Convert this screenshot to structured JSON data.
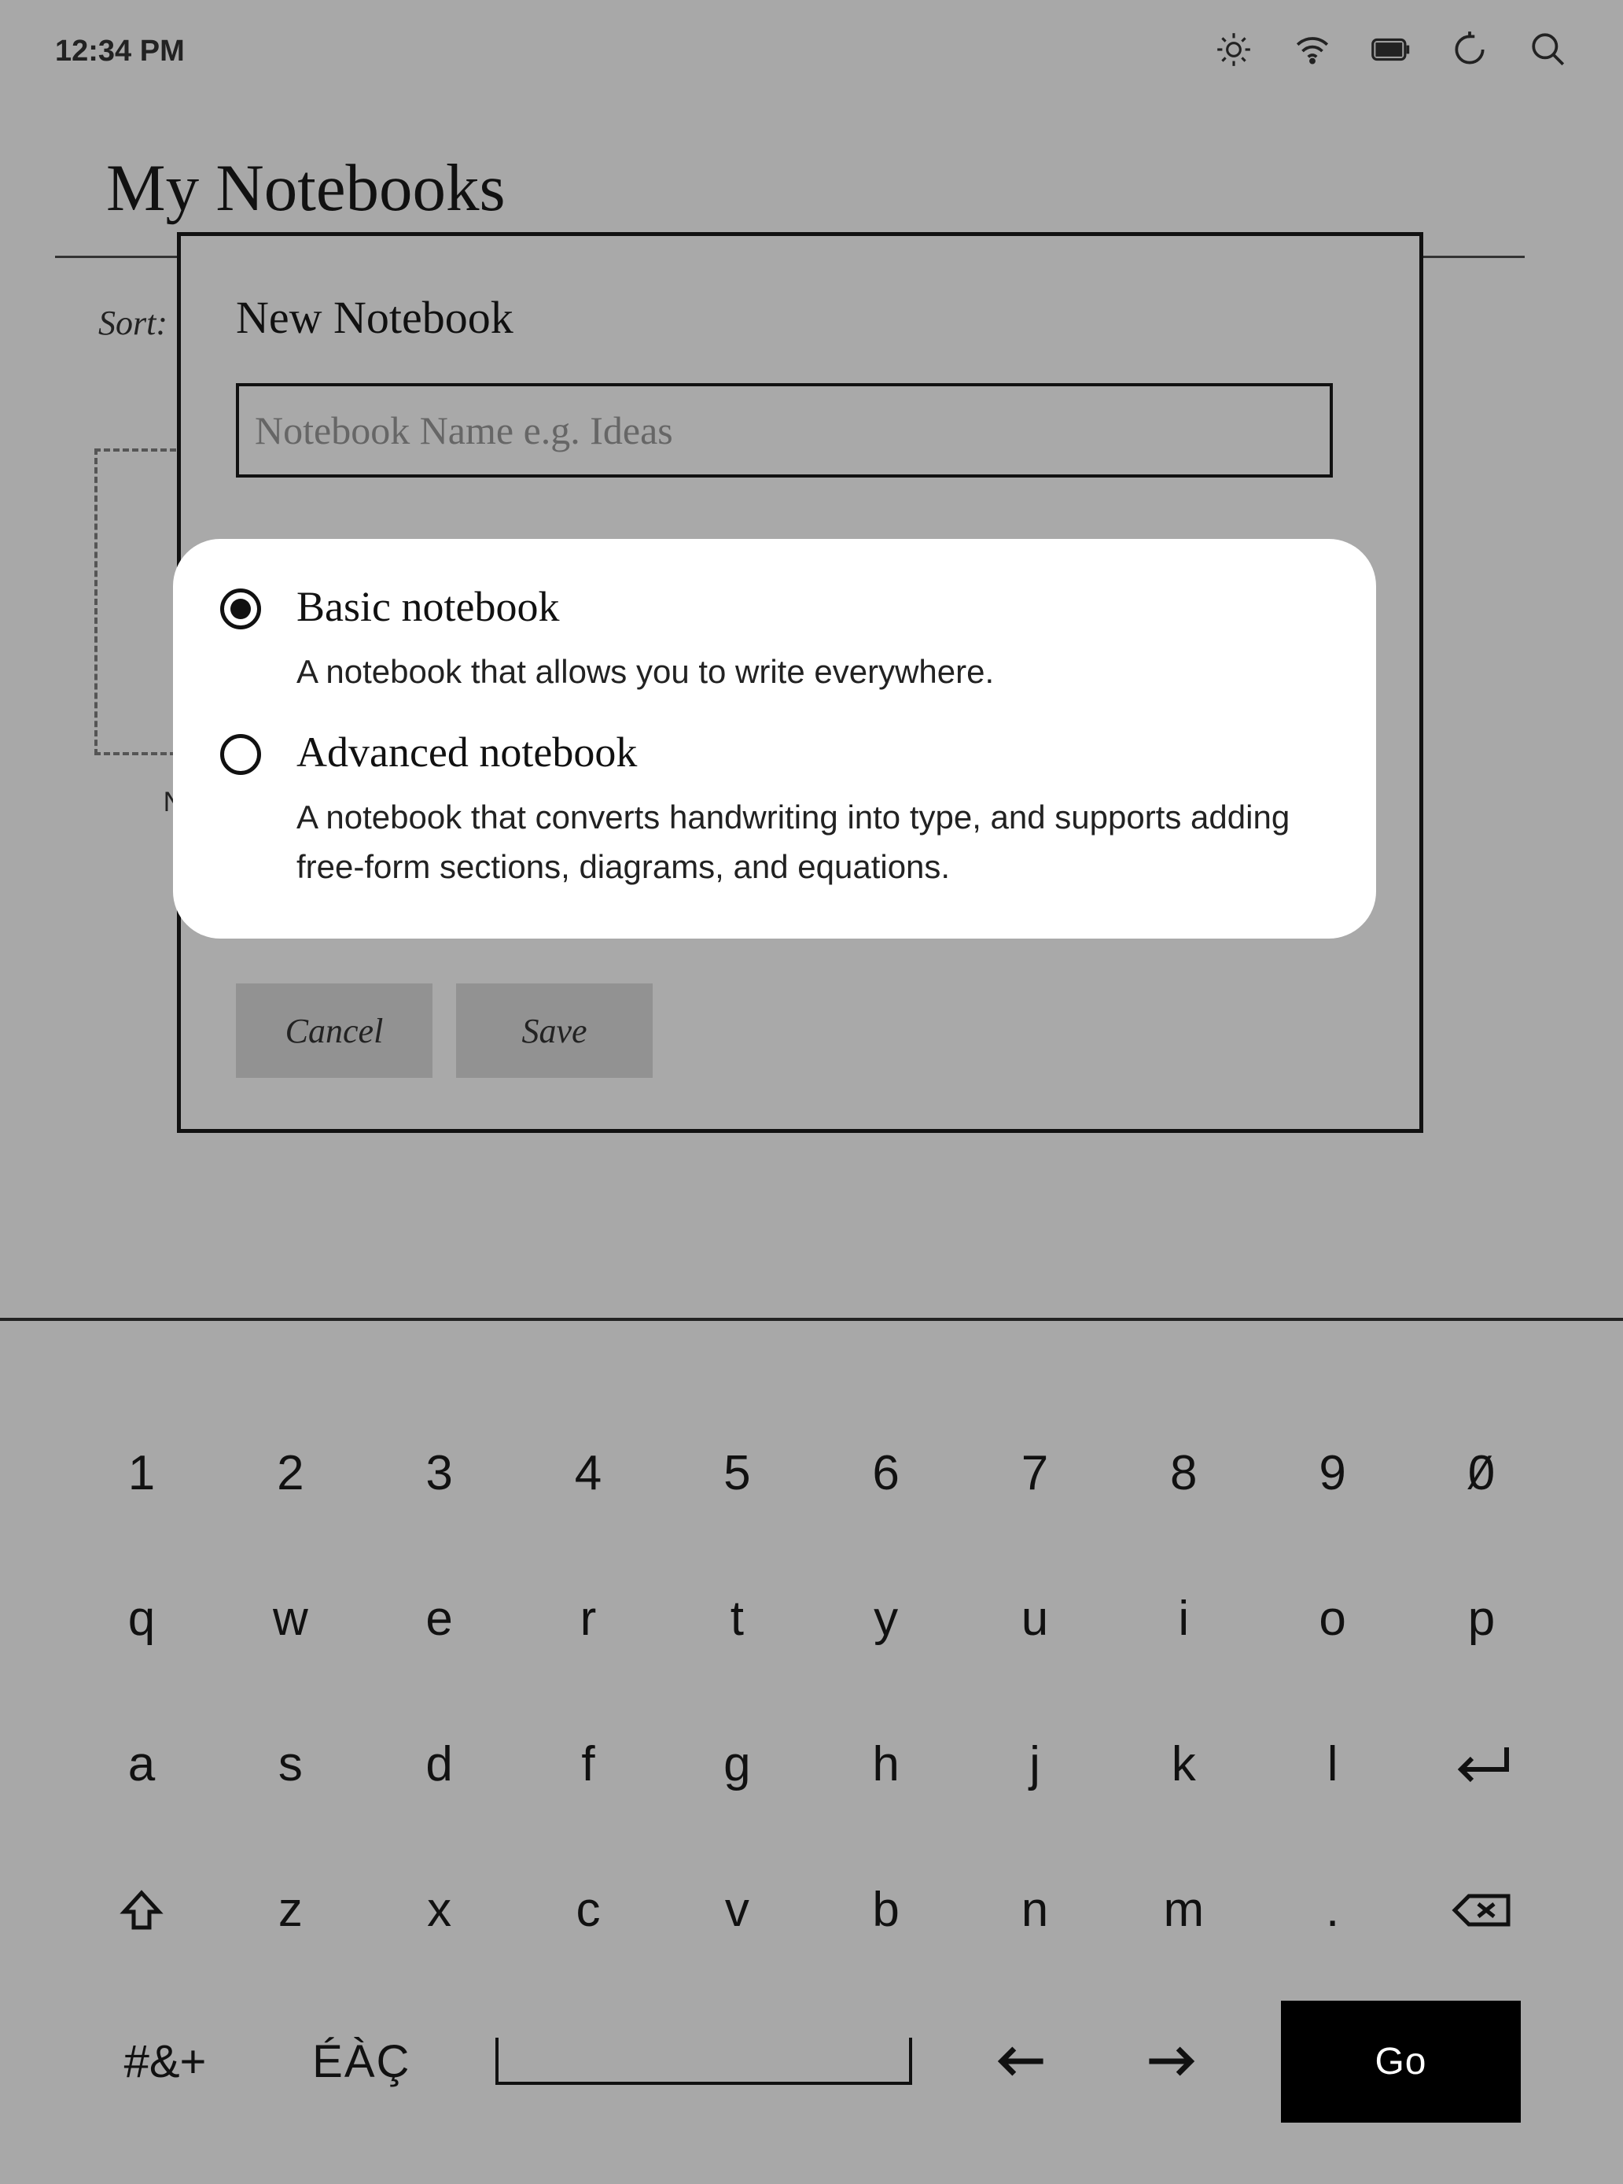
{
  "status": {
    "time": "12:34 PM"
  },
  "page": {
    "title": "My Notebooks",
    "sort_label": "Sort:",
    "new_tile_label": "NEW"
  },
  "modal": {
    "title": "New Notebook",
    "name_placeholder": "Notebook Name e.g. Ideas",
    "options": [
      {
        "title": "Basic notebook",
        "desc": "A notebook that allows you to write everywhere.",
        "selected": true
      },
      {
        "title": "Advanced notebook",
        "desc": "A notebook that converts handwriting into type, and supports adding free-form sections, diagrams, and equations.",
        "selected": false
      }
    ],
    "cancel": "Cancel",
    "save": "Save"
  },
  "keyboard": {
    "row1": [
      "1",
      "2",
      "3",
      "4",
      "5",
      "6",
      "7",
      "8",
      "9",
      "0"
    ],
    "row2": [
      "q",
      "w",
      "e",
      "r",
      "t",
      "y",
      "u",
      "i",
      "o",
      "p"
    ],
    "row3_letters": [
      "a",
      "s",
      "d",
      "f",
      "g",
      "h",
      "j",
      "k",
      "l"
    ],
    "row4_letters": [
      "z",
      "x",
      "c",
      "v",
      "b",
      "n",
      "m",
      "."
    ],
    "symbols": "#&+",
    "accents": "ÉÀÇ",
    "go": "Go",
    "zero_slash": "0"
  }
}
